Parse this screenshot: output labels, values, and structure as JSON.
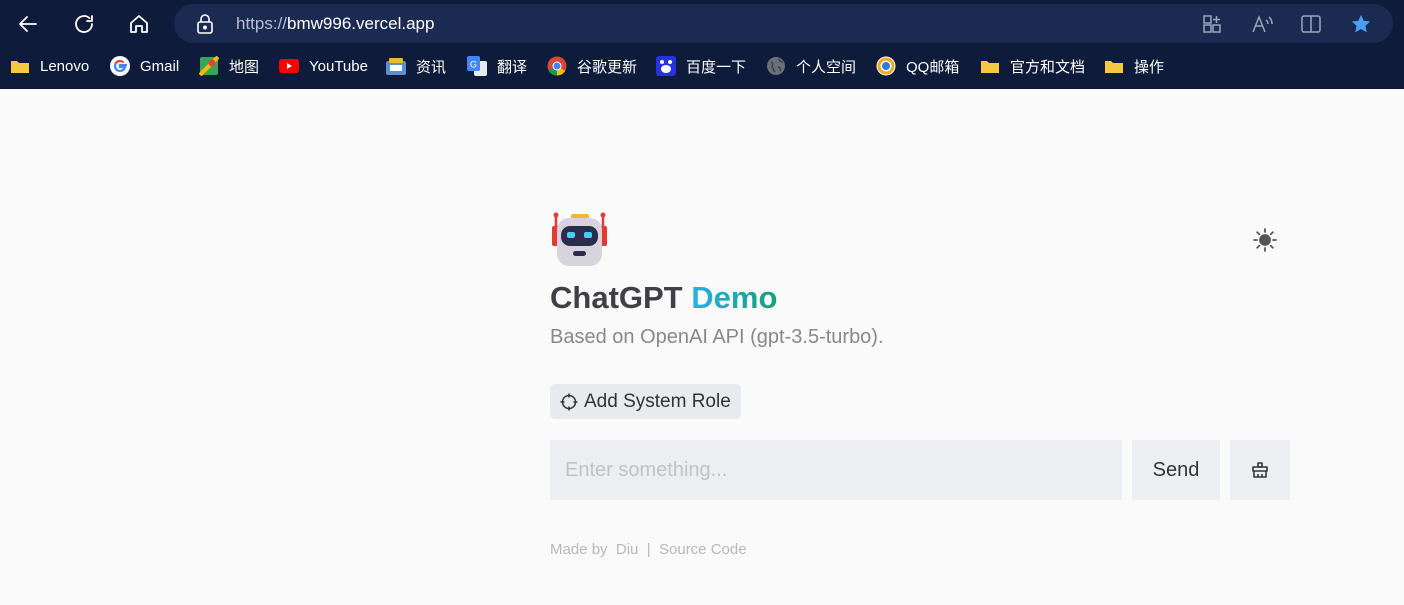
{
  "browser": {
    "url_protocol": "https://",
    "url_host": "bmw996.vercel.app",
    "bookmarks": [
      {
        "label": "Lenovo",
        "icon": "folder-icon"
      },
      {
        "label": "Gmail",
        "icon": "google-icon"
      },
      {
        "label": "地图",
        "icon": "maps-icon"
      },
      {
        "label": "YouTube",
        "icon": "youtube-icon"
      },
      {
        "label": "资讯",
        "icon": "news-icon"
      },
      {
        "label": "翻译",
        "icon": "translate-icon"
      },
      {
        "label": "谷歌更新",
        "icon": "chrome-icon"
      },
      {
        "label": "百度一下",
        "icon": "baidu-icon"
      },
      {
        "label": "个人空间",
        "icon": "globe-icon"
      },
      {
        "label": "QQ邮箱",
        "icon": "qqmail-icon"
      },
      {
        "label": "官方和文档",
        "icon": "folder-icon"
      },
      {
        "label": "操作",
        "icon": "folder-icon"
      }
    ]
  },
  "app": {
    "title_main": "ChatGPT",
    "title_accent": "Demo",
    "subtitle": "Based on OpenAI API (gpt-3.5-turbo).",
    "add_role_label": "Add System Role",
    "input_placeholder": "Enter something...",
    "send_label": "Send",
    "footer": {
      "made_by": "Made by",
      "author": "Diu",
      "separator": "|",
      "source": "Source Code"
    }
  },
  "colors": {
    "browser_bg": "#0f1b3a",
    "address_bar": "#1b2a51",
    "accent_start": "#2ab0ea",
    "accent_end": "#14a07a",
    "page_bg": "#fafafa"
  }
}
